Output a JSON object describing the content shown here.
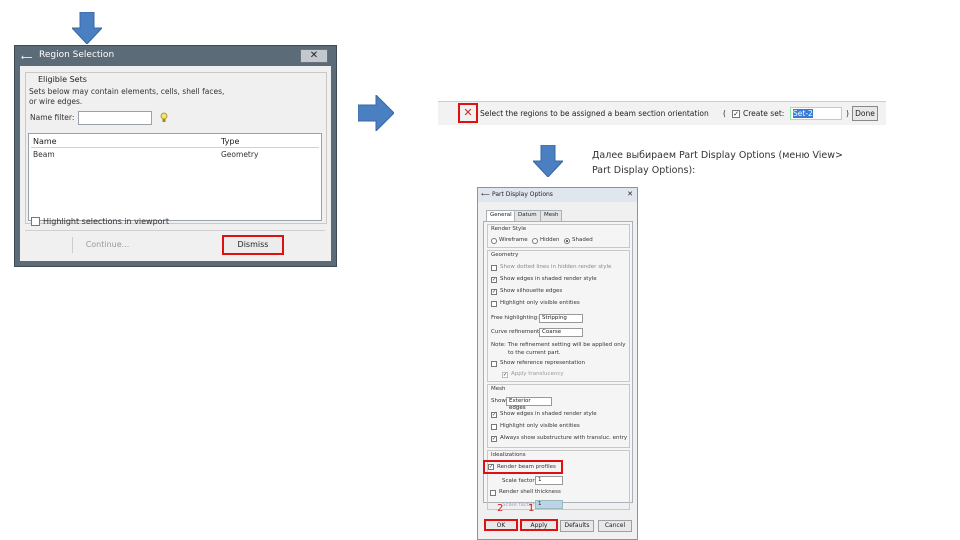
{
  "region_selection": {
    "title": "Region Selection",
    "close": "✕",
    "group_label": "Eligible Sets",
    "help_text_1": "Sets below may contain elements, cells, shell faces,",
    "help_text_2": "or wire edges.",
    "name_filter_label": "Name filter:",
    "name_filter_value": "",
    "columns": [
      "Name",
      "Type"
    ],
    "rows": [
      [
        "Beam",
        "Geometry"
      ]
    ],
    "highlight_label": "Highlight selections in viewport",
    "continue_label": "Continue...",
    "dismiss_label": "Dismiss"
  },
  "prompt_toolbar": {
    "cancel_glyph": "✕",
    "prompt": "Select the regions to be assigned a beam section orientation",
    "paren_open": "(",
    "create_set_label": "Create set:",
    "create_set_value": "Set-2",
    "paren_close": ")",
    "done_label": "Done"
  },
  "instruction_text": {
    "line1": "Далее выбираем Part Display Options (меню View>",
    "line2": "Part Display Options):"
  },
  "part_display_options": {
    "title": "Part Display Options",
    "close": "✕",
    "tabs": [
      "General",
      "Datum",
      "Mesh"
    ],
    "render_style": {
      "label": "Render Style",
      "options": [
        "Wireframe",
        "Hidden",
        "Shaded"
      ],
      "selected": "Shaded"
    },
    "geometry": {
      "label": "Geometry",
      "checks": [
        {
          "label": "Show dotted lines in hidden render style",
          "checked": false
        },
        {
          "label": "Show edges in shaded render style",
          "checked": true
        },
        {
          "label": "Show silhouette edges",
          "checked": true
        },
        {
          "label": "Highlight only visible entities",
          "checked": false
        }
      ],
      "free_highlight_label": "Free highlighting:",
      "free_highlight_value": "Stripping",
      "curve_refinement_label": "Curve refinement:",
      "curve_refinement_value": "Coarse",
      "note_1": "Note: The refinement setting will be applied only",
      "note_2": "to the current part.",
      "show_reference_label": "Show reference representation",
      "apply_translucency_label": "Apply translucency"
    },
    "mesh": {
      "label": "Mesh",
      "show_label": "Show:",
      "show_value": "Exterior edges",
      "checks": [
        {
          "label": "Show edges in shaded render style",
          "checked": true
        },
        {
          "label": "Highlight only visible entities",
          "checked": false
        },
        {
          "label": "Always show substructure with transluc. entry",
          "checked": true
        }
      ]
    },
    "idealizations": {
      "label": "Idealizations",
      "render_beam_label": "Render beam profiles",
      "render_beam_checked": true,
      "scale_factor_label": "Scale factor:",
      "scale_factor_value": "1",
      "render_shell_label": "Render shell thickness",
      "render_shell_checked": false,
      "scale_factor2_label": "Scale factor:",
      "scale_factor2_value": "1"
    },
    "buttons": [
      "OK",
      "Apply",
      "Defaults",
      "Cancel"
    ],
    "step_markers": [
      "2",
      "1"
    ]
  },
  "colors": {
    "arrow": "#4a7fc1",
    "highlight": "#dd1111",
    "dialog_frame": "#5c6b78"
  }
}
